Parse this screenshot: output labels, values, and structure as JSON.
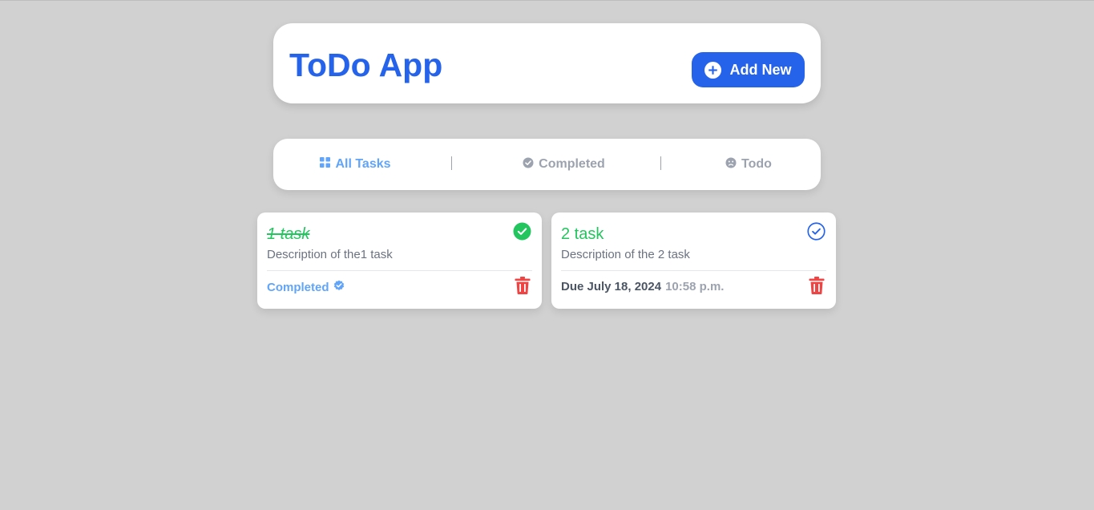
{
  "header": {
    "title": "ToDo App",
    "add_button_label": "Add New"
  },
  "filters": [
    {
      "label": "All Tasks",
      "icon": "grid-icon",
      "active": true
    },
    {
      "label": "Completed",
      "icon": "check-badge-icon",
      "active": false
    },
    {
      "label": "Todo",
      "icon": "frown-icon",
      "active": false
    }
  ],
  "tasks": [
    {
      "title": "1 task",
      "description": "Description of the1 task",
      "completed": true,
      "status_icon": "check-circle-filled-icon",
      "footer_label": "Completed"
    },
    {
      "title": "2 task",
      "description": "Description of the 2 task",
      "completed": false,
      "status_icon": "check-circle-outline-icon",
      "due_label": "Due July 18, 2024",
      "due_time": "10:58 p.m."
    }
  ],
  "colors": {
    "background": "#d1d1d1",
    "primary": "#2563eb",
    "active_tab": "#60a5fa",
    "inactive_tab": "#9ca3af",
    "task_title": "#22c55e",
    "delete": "#ef4444"
  }
}
